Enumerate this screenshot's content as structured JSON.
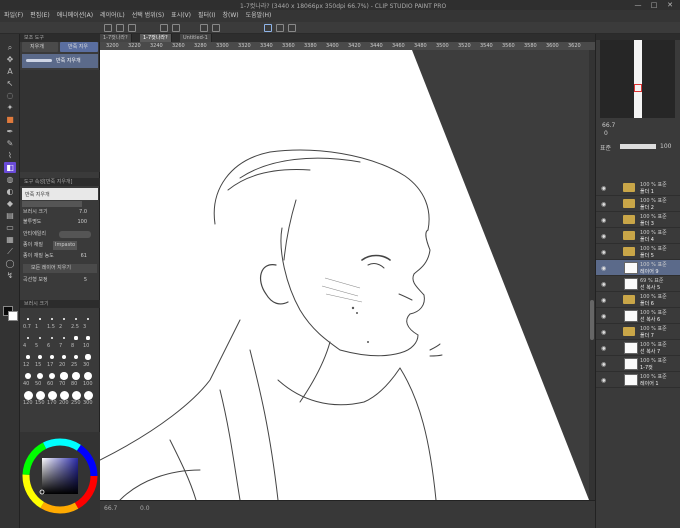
{
  "window": {
    "title": "1-7컷나라? (3440 x 18066px 350dpi 66.7%) - CLIP STUDIO PAINT PRO",
    "controls": [
      "—",
      "□",
      "✕"
    ]
  },
  "menu": [
    "파일(F)",
    "편집(E)",
    "애니메이션(A)",
    "레이어(L)",
    "선택 범위(S)",
    "표시(V)",
    "필터(I)",
    "창(W)",
    "도움말(H)"
  ],
  "tabs": [
    "1-7컷나라?",
    "1-7컷나라?",
    "Untitled-1"
  ],
  "ruler": {
    "ticks": [
      "3200",
      "3220",
      "3240",
      "3260",
      "3280",
      "3300",
      "3320",
      "3340",
      "3360",
      "3380",
      "3400",
      "3420",
      "3440",
      "3460",
      "3480",
      "3500",
      "3520",
      "3540",
      "3560",
      "3580",
      "3600",
      "3620",
      "3640"
    ]
  },
  "tool_property": {
    "header": "보조 도구",
    "buttons": [
      "지우개",
      "반죽 지우"
    ],
    "brush_name": "반죽 지우개"
  },
  "sub_tool_detail": {
    "header": "도구 속성[반죽 지우개]",
    "title": "반죽 지우개",
    "rows": [
      {
        "label": "브러시 크기",
        "value": "7.0"
      },
      {
        "label": "불투명도",
        "value": "100"
      },
      {
        "label": "안티에일리",
        "value": ""
      },
      {
        "label": "종이 재질",
        "value": "Impasto"
      },
      {
        "label": "종이 재질 농도",
        "value": "61"
      },
      {
        "label": "모든 레이어 지우기",
        "value": ""
      },
      {
        "label": "곡선형 보정",
        "value": "5"
      }
    ]
  },
  "brush_size": {
    "header": "브러시 크기",
    "sizes": [
      "0.7",
      "1",
      "1.5",
      "2",
      "2.5",
      "3",
      "4",
      "5",
      "6",
      "7",
      "8",
      "10",
      "12",
      "15",
      "17",
      "20",
      "25",
      "30",
      "40",
      "50",
      "60",
      "70",
      "80",
      "100",
      "120",
      "150",
      "170",
      "200",
      "250",
      "300"
    ]
  },
  "color": {
    "main": "#0a0a0a",
    "sub": "#ffffff",
    "wheel_square": "#3a3a6a"
  },
  "status": {
    "zoom": "66.7",
    "angle": "0.0"
  },
  "right_panel": {
    "zoom_value": "66.7",
    "angle_value": "0",
    "layer_opacity": "100",
    "blend_mode": "표준"
  },
  "layers": [
    {
      "blend": "100 % 표준",
      "name": "폴더 1",
      "type": "folder"
    },
    {
      "blend": "100 % 표준",
      "name": "폴더 2",
      "type": "folder"
    },
    {
      "blend": "100 % 표준",
      "name": "폴더 3",
      "type": "folder"
    },
    {
      "blend": "100 % 표준",
      "name": "폴더 4",
      "type": "folder"
    },
    {
      "blend": "100 % 표준",
      "name": "폴더 5",
      "type": "folder"
    },
    {
      "blend": "100 % 표준",
      "name": "레이어 9",
      "type": "layer",
      "selected": true
    },
    {
      "blend": "69 % 표준",
      "name": "선 복사 5",
      "type": "layer"
    },
    {
      "blend": "100 % 표준",
      "name": "폴더 6",
      "type": "folder"
    },
    {
      "blend": "100 % 표준",
      "name": "선 복사 6",
      "type": "layer"
    },
    {
      "blend": "100 % 표준",
      "name": "폴더 7",
      "type": "folder"
    },
    {
      "blend": "100 % 표준",
      "name": "선 복사 7",
      "type": "layer"
    },
    {
      "blend": "100 % 표준",
      "name": "1-7컷",
      "type": "layer"
    },
    {
      "blend": "100 % 표준",
      "name": "레이어 1",
      "type": "layer"
    }
  ]
}
